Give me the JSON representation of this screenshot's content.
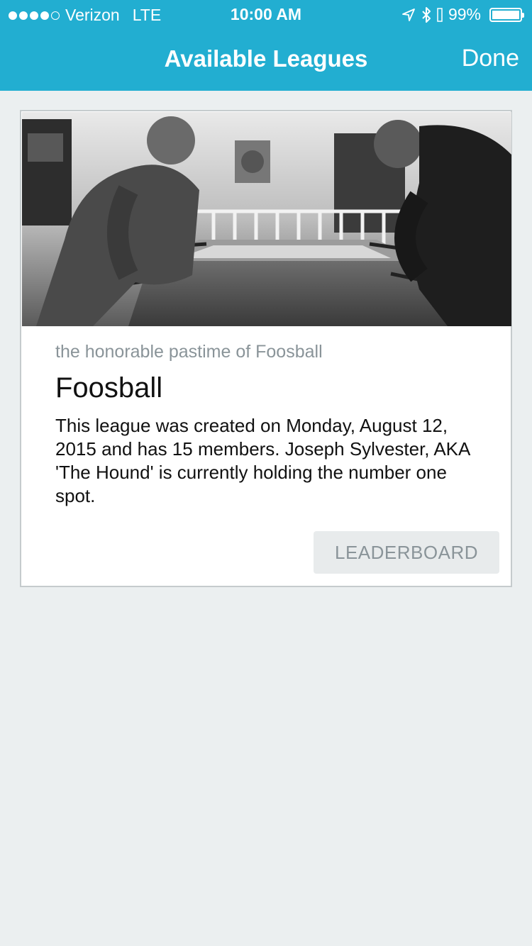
{
  "status_bar": {
    "carrier": "Verizon",
    "network": "LTE",
    "time": "10:00 AM",
    "battery": "99%",
    "battery_level": 0.99,
    "signal_bars_filled": 4,
    "signal_bars_total": 5,
    "icons": [
      "location-arrow-icon",
      "bluetooth-icon",
      "battery-icon"
    ]
  },
  "nav": {
    "title": "Available Leagues",
    "done_label": "Done"
  },
  "league_card": {
    "image": "foosball-players-photo",
    "subtitle": "the honorable pastime of Foosball",
    "title": "Foosball",
    "description": "This league was created on Monday, August 12, 2015 and has 15 members. Joseph Sylvester, AKA 'The Hound' is currently holding the number one spot.",
    "button_label": "LEADERBOARD"
  },
  "colors": {
    "accent": "#22aed1",
    "background": "#ebeff0",
    "card": "#ffffff",
    "muted_text": "#8a9499"
  }
}
